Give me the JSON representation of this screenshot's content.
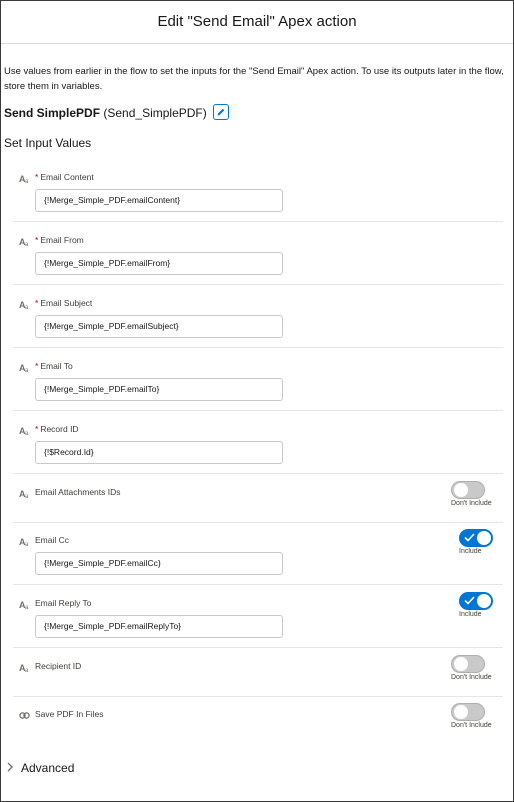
{
  "header": {
    "title": "Edit \"Send Email\" Apex action"
  },
  "intro": "Use values from earlier in the flow to set the inputs for the \"Send Email\" Apex action. To use its outputs later in the flow, store them in variables.",
  "action": {
    "label": "Send SimplePDF",
    "api_name": "(Send_SimplePDF)"
  },
  "section_title": "Set Input Values",
  "fields": [
    {
      "label": "Email Content",
      "required": "*",
      "value": "{!Merge_Simple_PDF.emailContent}"
    },
    {
      "label": "Email From",
      "required": "*",
      "value": "{!Merge_Simple_PDF.emailFrom}"
    },
    {
      "label": "Email Subject",
      "required": "*",
      "value": "{!Merge_Simple_PDF.emailSubject}"
    },
    {
      "label": "Email To",
      "required": "*",
      "value": "{!Merge_Simple_PDF.emailTo}"
    },
    {
      "label": "Record ID",
      "required": "*",
      "value": "{!$Record.Id}"
    },
    {
      "label": "Email Attachments IDs",
      "toggle_label": "Don't Include",
      "toggle_on": false
    },
    {
      "label": "Email Cc",
      "value": "{!Merge_Simple_PDF.emailCc}",
      "toggle_label": "Include",
      "toggle_on": true
    },
    {
      "label": "Email Reply To",
      "value": "{!Merge_Simple_PDF.emailReplyTo}",
      "toggle_label": "Include",
      "toggle_on": true
    },
    {
      "label": "Recipient ID",
      "toggle_label": "Don't Include",
      "toggle_on": false
    },
    {
      "label": "Save PDF In Files",
      "toggle_label": "Don't Include",
      "toggle_on": false
    }
  ],
  "advanced": {
    "label": "Advanced"
  },
  "colors": {
    "accent": "#0176d3",
    "required": "#ba0517",
    "toggle_off": "#c9c9c9"
  },
  "icons": {
    "text_type": "text-type-icon",
    "boolean_type": "boolean-type-icon",
    "edit": "pencil-icon",
    "chevron": "chevron-right-icon",
    "check": "check-icon"
  }
}
